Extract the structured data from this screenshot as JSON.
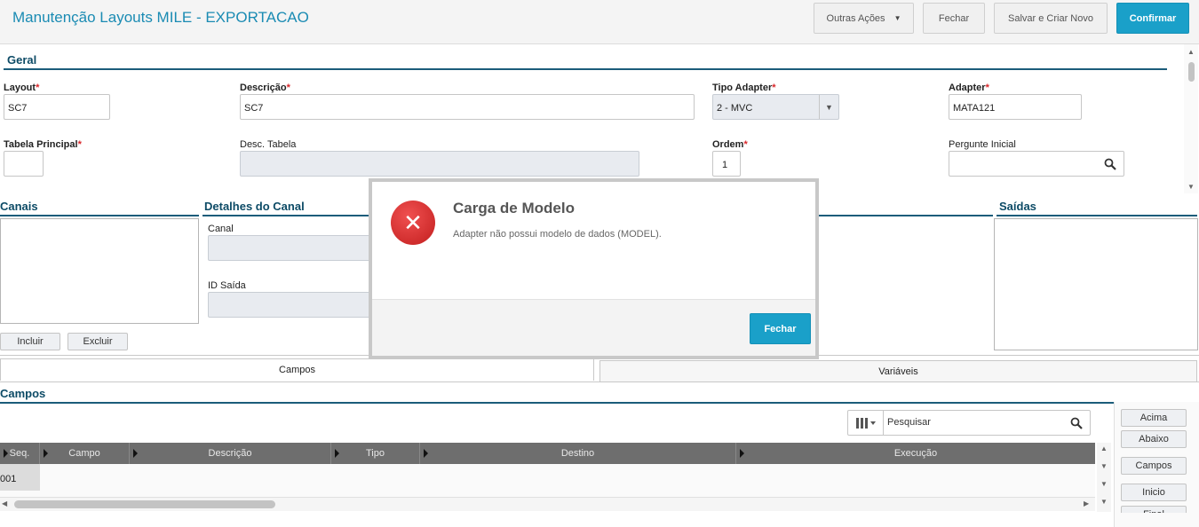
{
  "header": {
    "title": "Manutenção Layouts MILE - EXPORTACAO",
    "buttons": {
      "outras": "Outras Ações",
      "fechar": "Fechar",
      "salvar": "Salvar e Criar Novo",
      "confirmar": "Confirmar"
    }
  },
  "geral": {
    "section": "Geral",
    "layout_label": "Layout",
    "layout_value": "SC7",
    "descricao_label": "Descrição",
    "descricao_value": "SC7",
    "tipo_label": "Tipo Adapter",
    "tipo_value": "2 - MVC",
    "adapter_label": "Adapter",
    "adapter_value": "MATA121",
    "tabela_label": "Tabela Principal",
    "tabela_value": "",
    "desc_tabela_label": "Desc. Tabela",
    "desc_tabela_value": "",
    "ordem_label": "Ordem",
    "ordem_value": "1",
    "pergunte_label": "Pergunte Inicial",
    "pergunte_value": "",
    "required_mark": "*"
  },
  "canais": {
    "section": "Canais",
    "incluir": "Incluir",
    "excluir": "Excluir"
  },
  "detalhes": {
    "section": "Detalhes do Canal",
    "canal_label": "Canal",
    "id_saida_label": "ID Saída"
  },
  "saidas": {
    "section": "Saídas"
  },
  "tabs": {
    "campos": "Campos",
    "variaveis": "Variáveis"
  },
  "campos": {
    "section": "Campos",
    "search_placeholder": "Pesquisar",
    "columns": [
      "Seq.",
      "Campo",
      "Descrição",
      "Tipo",
      "Destino",
      "Execução"
    ],
    "rows": [
      {
        "seq": "001"
      }
    ],
    "side_buttons": {
      "acima": "Acima",
      "abaixo": "Abaixo",
      "campos": "Campos",
      "inicio": "Inicio",
      "final": "Final"
    }
  },
  "modal": {
    "title": "Carga de Modelo",
    "message": "Adapter não possui modelo de dados (MODEL).",
    "close": "Fechar",
    "icon": "x"
  },
  "colors": {
    "accent": "#1aa0c9",
    "title": "#1a8bb3",
    "section": "#0d4b66",
    "error": "#d9262a"
  }
}
